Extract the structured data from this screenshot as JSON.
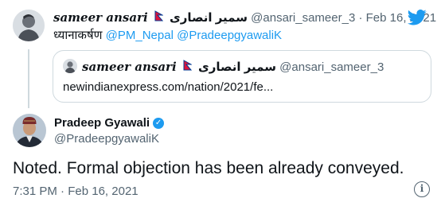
{
  "tweet1": {
    "display_name": "sameer ansari",
    "name_urdu": "سمیر انصاری",
    "handle": "@ansari_sameer_3",
    "separator": "·",
    "date": "Feb 16, 2021",
    "body_prefix": "ध्यानाकर्षण",
    "mention1": "@PM_Nepal",
    "mention2": "@PradeepgyawaliK"
  },
  "quote": {
    "display_name": "sameer ansari",
    "name_urdu": "سمیر انصاری",
    "handle": "@ansari_sameer_3",
    "link_text": "newindianexpress.com/nation/2021/fe..."
  },
  "tweet2": {
    "display_name": "Pradeep Gyawali",
    "handle": "@PradeepgyawaliK",
    "body": "Noted. Formal objection has been already conveyed.",
    "time": "7:31 PM",
    "separator": "·",
    "date": "Feb 16, 2021"
  },
  "icons": {
    "twitter": "twitter-bird-icon",
    "verified": "verified-badge-icon",
    "info": "info-icon",
    "flag": "nepal-flag-icon"
  },
  "colors": {
    "link": "#1d9bf0",
    "muted": "#536471",
    "text": "#0f1419",
    "flag_red": "#dc143c",
    "flag_blue": "#003893"
  }
}
